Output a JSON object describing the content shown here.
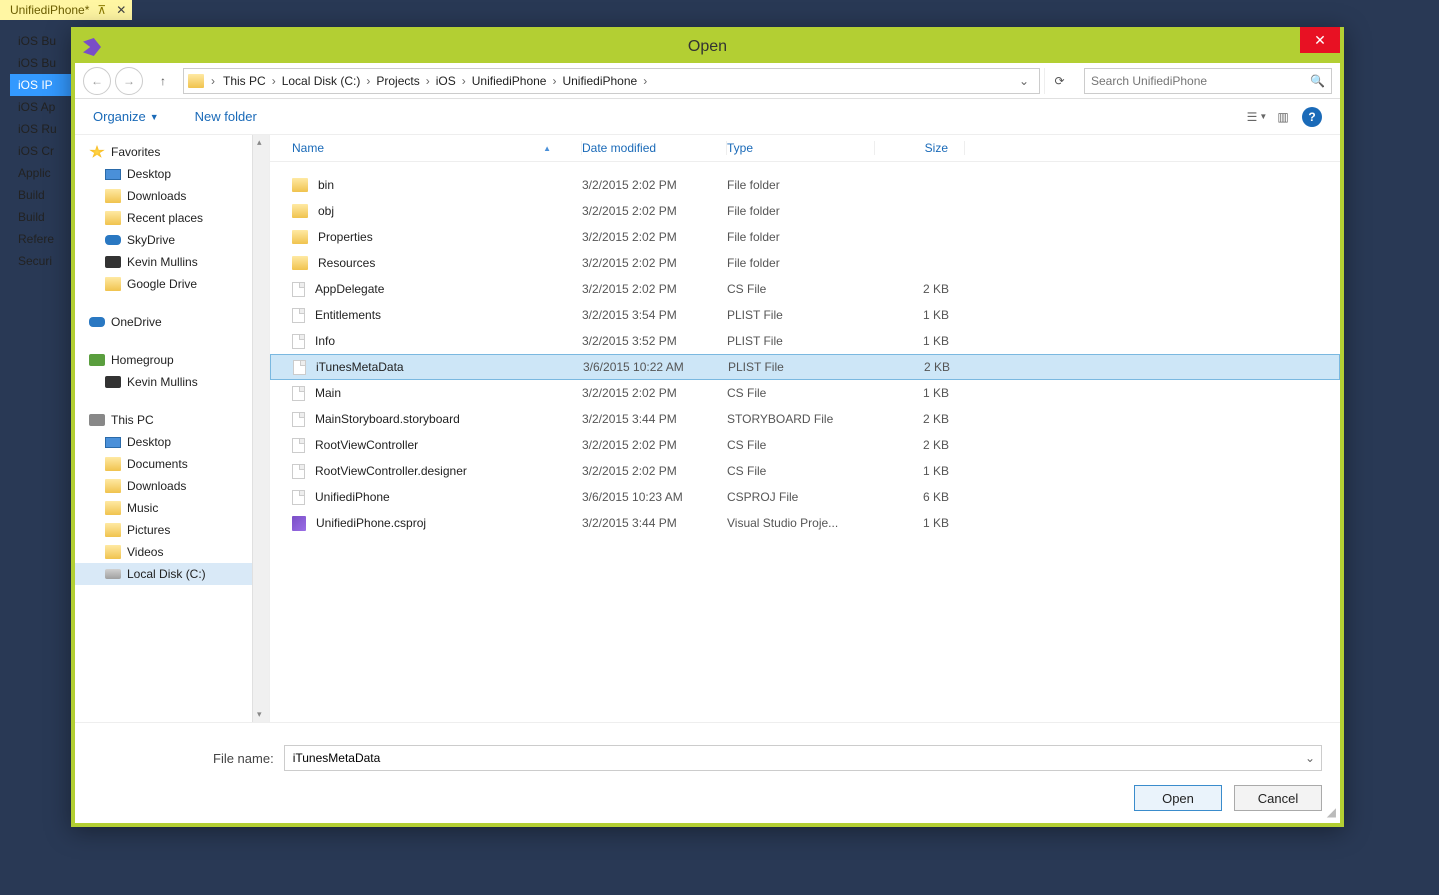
{
  "vs_tab": {
    "label": "UnifiediPhone*"
  },
  "sidebar_items": [
    {
      "label": "iOS Bu",
      "selected": false
    },
    {
      "label": "iOS Bu",
      "selected": false
    },
    {
      "label": "iOS IP",
      "selected": true
    },
    {
      "label": "iOS Ap",
      "selected": false
    },
    {
      "label": "iOS Ru",
      "selected": false
    },
    {
      "label": "iOS Cr",
      "selected": false
    },
    {
      "label": "Applic",
      "selected": false
    },
    {
      "label": "Build",
      "selected": false
    },
    {
      "label": "Build",
      "selected": false
    },
    {
      "label": "Refere",
      "selected": false
    },
    {
      "label": "Securi",
      "selected": false
    }
  ],
  "dialog": {
    "title": "Open",
    "breadcrumb": [
      "This PC",
      "Local Disk (C:)",
      "Projects",
      "iOS",
      "UnifiediPhone",
      "UnifiediPhone"
    ],
    "search_placeholder": "Search UnifiediPhone",
    "toolbar": {
      "organize": "Organize",
      "new_folder": "New folder"
    },
    "filename_label": "File name:",
    "filename_value": "iTunesMetaData",
    "buttons": {
      "open": "Open",
      "cancel": "Cancel"
    }
  },
  "navtree": [
    {
      "type": "group",
      "icon": "star",
      "label": "Favorites"
    },
    {
      "type": "item",
      "icon": "screen",
      "label": "Desktop"
    },
    {
      "type": "item",
      "icon": "folder",
      "label": "Downloads"
    },
    {
      "type": "item",
      "icon": "folder",
      "label": "Recent places"
    },
    {
      "type": "item",
      "icon": "cloud",
      "label": "SkyDrive"
    },
    {
      "type": "item",
      "icon": "user",
      "label": "Kevin Mullins"
    },
    {
      "type": "item",
      "icon": "folder",
      "label": "Google Drive"
    },
    {
      "type": "spacer"
    },
    {
      "type": "group",
      "icon": "cloud",
      "label": "OneDrive"
    },
    {
      "type": "spacer"
    },
    {
      "type": "group",
      "icon": "home",
      "label": "Homegroup"
    },
    {
      "type": "item",
      "icon": "user",
      "label": "Kevin Mullins"
    },
    {
      "type": "spacer"
    },
    {
      "type": "group",
      "icon": "pc",
      "label": "This PC"
    },
    {
      "type": "item",
      "icon": "screen",
      "label": "Desktop"
    },
    {
      "type": "item",
      "icon": "folder",
      "label": "Documents"
    },
    {
      "type": "item",
      "icon": "folder",
      "label": "Downloads"
    },
    {
      "type": "item",
      "icon": "folder",
      "label": "Music"
    },
    {
      "type": "item",
      "icon": "folder",
      "label": "Pictures"
    },
    {
      "type": "item",
      "icon": "folder",
      "label": "Videos"
    },
    {
      "type": "item",
      "icon": "drive",
      "label": "Local Disk (C:)",
      "selected": true
    }
  ],
  "columns": {
    "name": "Name",
    "date": "Date modified",
    "type": "Type",
    "size": "Size"
  },
  "files": [
    {
      "icon": "folder",
      "name": "bin",
      "date": "3/2/2015 2:02 PM",
      "type": "File folder",
      "size": ""
    },
    {
      "icon": "folder",
      "name": "obj",
      "date": "3/2/2015 2:02 PM",
      "type": "File folder",
      "size": ""
    },
    {
      "icon": "folder",
      "name": "Properties",
      "date": "3/2/2015 2:02 PM",
      "type": "File folder",
      "size": ""
    },
    {
      "icon": "folder",
      "name": "Resources",
      "date": "3/2/2015 2:02 PM",
      "type": "File folder",
      "size": ""
    },
    {
      "icon": "file",
      "name": "AppDelegate",
      "date": "3/2/2015 2:02 PM",
      "type": "CS File",
      "size": "2 KB"
    },
    {
      "icon": "file",
      "name": "Entitlements",
      "date": "3/2/2015 3:54 PM",
      "type": "PLIST File",
      "size": "1 KB"
    },
    {
      "icon": "file",
      "name": "Info",
      "date": "3/2/2015 3:52 PM",
      "type": "PLIST File",
      "size": "1 KB"
    },
    {
      "icon": "file",
      "name": "iTunesMetaData",
      "date": "3/6/2015 10:22 AM",
      "type": "PLIST File",
      "size": "2 KB",
      "selected": true
    },
    {
      "icon": "file",
      "name": "Main",
      "date": "3/2/2015 2:02 PM",
      "type": "CS File",
      "size": "1 KB"
    },
    {
      "icon": "file",
      "name": "MainStoryboard.storyboard",
      "date": "3/2/2015 3:44 PM",
      "type": "STORYBOARD File",
      "size": "2 KB"
    },
    {
      "icon": "file",
      "name": "RootViewController",
      "date": "3/2/2015 2:02 PM",
      "type": "CS File",
      "size": "2 KB"
    },
    {
      "icon": "file",
      "name": "RootViewController.designer",
      "date": "3/2/2015 2:02 PM",
      "type": "CS File",
      "size": "1 KB"
    },
    {
      "icon": "file",
      "name": "UnifiediPhone",
      "date": "3/6/2015 10:23 AM",
      "type": "CSPROJ File",
      "size": "6 KB"
    },
    {
      "icon": "csproj",
      "name": "UnifiediPhone.csproj",
      "date": "3/2/2015 3:44 PM",
      "type": "Visual Studio Proje...",
      "size": "1 KB"
    }
  ]
}
